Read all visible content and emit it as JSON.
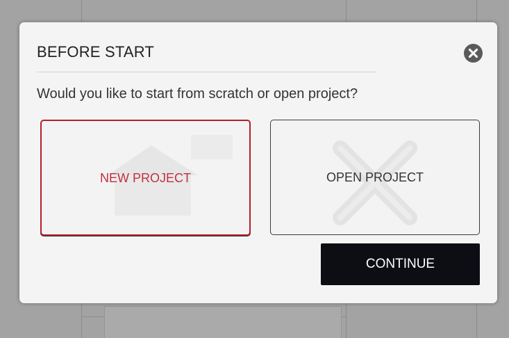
{
  "dialog": {
    "title": "BEFORE START",
    "prompt": "Would you like to start from scratch or open project?",
    "close_icon": "close-icon",
    "options": [
      {
        "label": "NEW PROJECT",
        "selected": true,
        "icon": "home-icon"
      },
      {
        "label": "OPEN PROJECT",
        "selected": false,
        "icon": "tools-icon"
      }
    ],
    "continue_label": "CONTINUE"
  },
  "colors": {
    "accent": "#c0303f",
    "selected_border": "#b21f2d",
    "continue_bg": "#0d0d14",
    "dialog_bg": "#f4f4f4",
    "overlay": "#a3a3a3"
  }
}
